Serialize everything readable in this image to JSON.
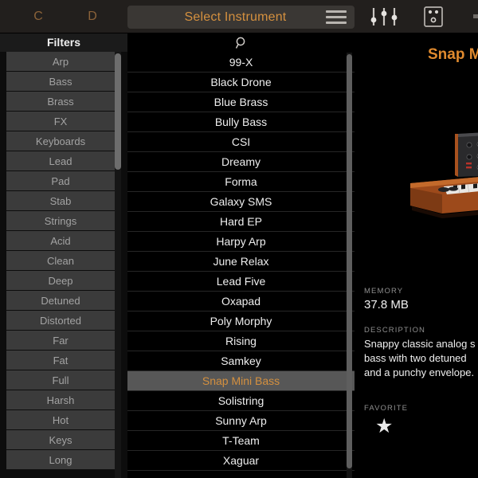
{
  "header": {
    "letters": [
      "C",
      "D"
    ],
    "instrument_select_label": "Select Instrument",
    "menu_icon": "hamburger-menu-icon",
    "faders_icon": "faders-icon",
    "pedal_icon": "pedal-device-icon",
    "accent_color": "#d4903f"
  },
  "filters": {
    "title": "Filters",
    "items": [
      "Arp",
      "Bass",
      "Brass",
      "FX",
      "Keyboards",
      "Lead",
      "Pad",
      "Stab",
      "Strings",
      "Acid",
      "Clean",
      "Deep",
      "Detuned",
      "Distorted",
      "Far",
      "Fat",
      "Full",
      "Harsh",
      "Hot",
      "Keys",
      "Long"
    ]
  },
  "presets": {
    "search_icon": "search-icon",
    "selected": "Snap Mini Bass",
    "items": [
      "99-X",
      "Black Drone",
      "Blue Brass",
      "Bully Bass",
      "CSI",
      "Dreamy",
      "Forma",
      "Galaxy SMS",
      "Hard EP",
      "Harpy Arp",
      "June Relax",
      "Lead Five",
      "Oxapad",
      "Poly Morphy",
      "Rising",
      "Samkey",
      "Snap Mini Bass",
      "Solistring",
      "Sunny Arp",
      "T-Team",
      "Xaguar"
    ]
  },
  "detail": {
    "title": "Snap M",
    "artwork": "analog-synthesizer-image",
    "memory_label": "MEMORY",
    "memory_value": "37.8 MB",
    "description_label": "DESCRIPTION",
    "description_lines": [
      "Snappy classic analog s",
      "bass with two detuned",
      "and a punchy envelope."
    ],
    "favorite_label": "FAVORITE",
    "favorite_star": "★"
  }
}
